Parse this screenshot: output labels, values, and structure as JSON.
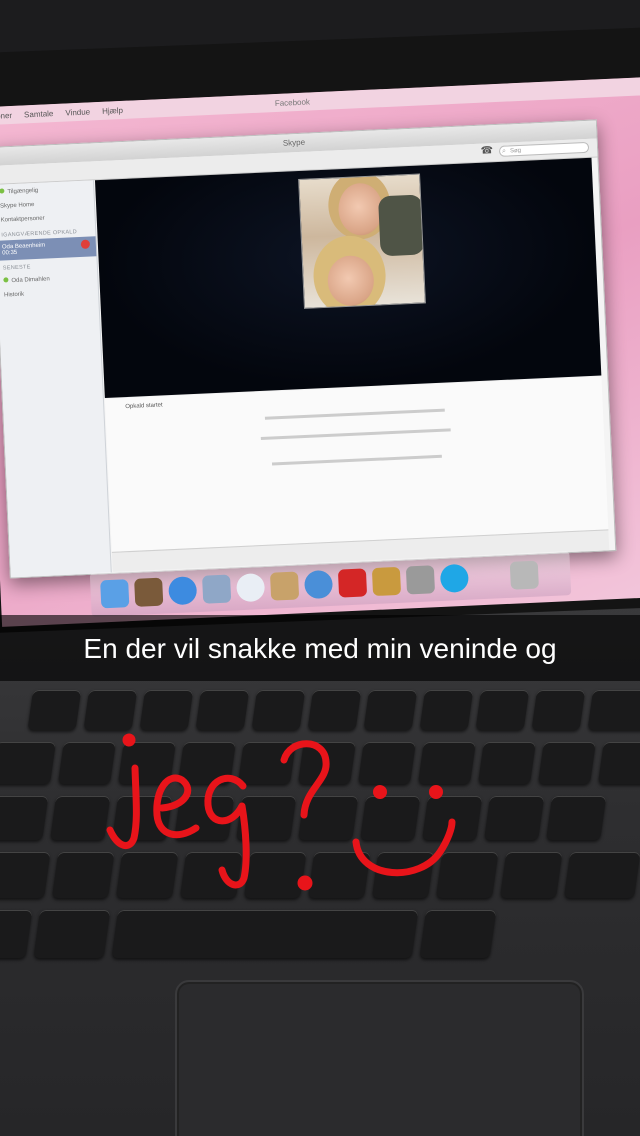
{
  "caption": {
    "text": "En der vil snakke med min veninde og"
  },
  "doodle": {
    "text": "jeg ?",
    "color": "#e8141a",
    "smiley_icon": "smiley-face-icon"
  },
  "menubar": {
    "items": [
      "ersoner",
      "Samtale",
      "Vindue",
      "Hjælp"
    ],
    "app_title": "Facebook"
  },
  "skype": {
    "window_title": "Skype",
    "search_placeholder": "Søg",
    "sidebar": {
      "user_status": "Tilgængelig",
      "items": [
        "Skype Home",
        "Kontaktpersoner"
      ],
      "section_recent": "IGANGVÆRENDE OPKALD",
      "active_call": "Oda Beaenheim",
      "active_call_time": "00:35",
      "section_recent2": "SENESTE",
      "recent": [
        "Oda Dimahlen",
        "Historik"
      ]
    },
    "chat": {
      "header": "Opkald startet"
    },
    "icons": {
      "phone": "phone-icon",
      "search": "search-icon"
    }
  },
  "colors": {
    "screen_pink": "#ea9fc2",
    "caption_bg": "#000000",
    "doodle_red": "#e8141a"
  }
}
